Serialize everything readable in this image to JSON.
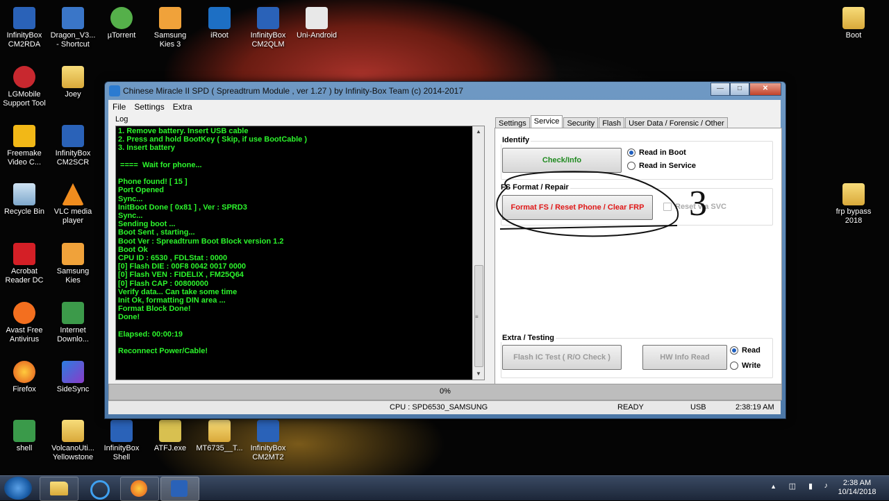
{
  "desktop": {
    "icons": [
      {
        "label": "InfinityBox CM2RDA",
        "tag": "RDA"
      },
      {
        "label": "Dragon_V3... - Shortcut",
        "tag": ""
      },
      {
        "label": "µTorrent",
        "tag": ""
      },
      {
        "label": "Samsung Kies 3",
        "tag": "3"
      },
      {
        "label": "iRoot",
        "tag": ""
      },
      {
        "label": "InfinityBox CM2QLM",
        "tag": "QLM"
      },
      {
        "label": "Uni-Android",
        "tag": ""
      },
      {
        "label": "Boot",
        "tag": ""
      },
      {
        "label": "LGMobile Support Tool",
        "tag": ""
      },
      {
        "label": "Joey",
        "tag": ""
      },
      {
        "label": "Freemake Video C...",
        "tag": ""
      },
      {
        "label": "InfinityBox CM2SCR",
        "tag": "SCR"
      },
      {
        "label": "Recycle Bin",
        "tag": ""
      },
      {
        "label": "VLC media player",
        "tag": ""
      },
      {
        "label": "frp bypass 2018",
        "tag": ""
      },
      {
        "label": "Acrobat Reader DC",
        "tag": ""
      },
      {
        "label": "Samsung Kies",
        "tag": ""
      },
      {
        "label": "Avast Free Antivirus",
        "tag": ""
      },
      {
        "label": "Internet Downlo...",
        "tag": ""
      },
      {
        "label": "Firefox",
        "tag": ""
      },
      {
        "label": "SideSync",
        "tag": ""
      },
      {
        "label": "shell",
        "tag": ""
      },
      {
        "label": "VolcanoUti... Yellowstone",
        "tag": ""
      },
      {
        "label": "InfinityBox Shell",
        "tag": ""
      },
      {
        "label": "ATFJ.exe",
        "tag": ""
      },
      {
        "label": "MT6735__T...",
        "tag": ""
      },
      {
        "label": "InfinityBox CM2MT2",
        "tag": "MTK"
      }
    ]
  },
  "window": {
    "title": "Chinese Miracle II SPD ( Spreadtrum Module , ver 1.27 ) by Infinity-Box Team (c) 2014-2017",
    "menu": [
      "File",
      "Settings",
      "Extra"
    ],
    "log_label": "Log",
    "log_lines": [
      "1. Remove battery. Insert USB cable",
      "2. Press and hold BootKey ( Skip, if use BootCable )",
      "3. Insert battery",
      "",
      " ====  Wait for phone...",
      "",
      "Phone found! [ 15 ]",
      "Port Opened",
      "Sync...",
      "InitBoot Done [ 0x81 ] , Ver : SPRD3",
      "Sync...",
      "Sending boot ...",
      "Boot Sent , starting...",
      "Boot Ver : Spreadtrum Boot Block version 1.2",
      "Boot Ok",
      "CPU ID : 6530 , FDLStat : 0000",
      "[0] Flash DIE : 00F8 0042 0017 0000",
      "[0] Flash VEN : FIDELIX , FM25Q64",
      "[0] Flash CAP : 00800000",
      "Verify data... Can take some time",
      "Init Ok, formatting DIN area ...",
      "Format Block Done!",
      "Done!",
      "",
      "Elapsed: 00:00:19",
      "",
      "Reconnect Power/Cable!"
    ],
    "tabs": [
      "Settings",
      "Service",
      "Security",
      "Flash",
      "User Data / Forensic / Other"
    ],
    "active_tab": "Service",
    "identify": {
      "title": "Identify",
      "check_button": "Check/Info",
      "radio_boot": "Read in Boot",
      "radio_service": "Read in Service"
    },
    "fs": {
      "title": "FS Format / Repair",
      "format_button": "Format FS / Reset Phone / Clear FRP",
      "reset_checkbox": "Reset via SVC",
      "annotation": "3"
    },
    "extra": {
      "title": "Extra / Testing",
      "flash_ic_button": "Flash IC Test ( R/O Check )",
      "hw_info_button": "HW Info Read",
      "radio_read": "Read",
      "radio_write": "Write"
    },
    "progress_text": "0%",
    "status": {
      "cpu": "CPU : SPD6530_SAMSUNG",
      "state": "READY",
      "conn": "USB",
      "time": "2:38:19 AM"
    }
  },
  "taskbar": {
    "clock_time": "2:38 AM",
    "clock_date": "10/14/2018"
  },
  "colors": {
    "log_text": "#2cf52c",
    "check_button_text": "#1f8a1f",
    "format_button_text": "#e01818"
  }
}
